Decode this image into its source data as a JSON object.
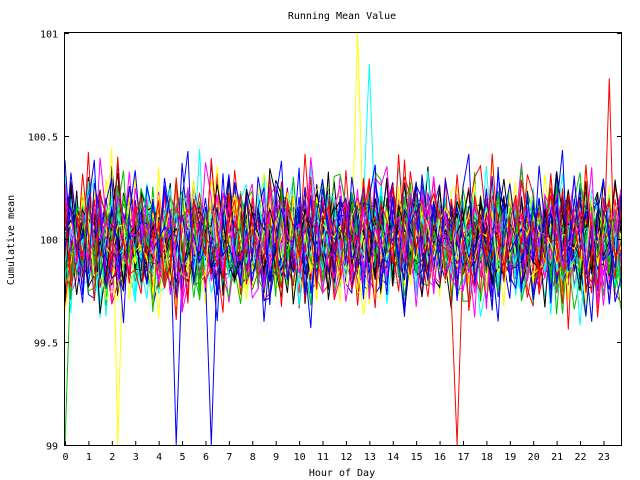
{
  "chart_data": {
    "type": "line",
    "title": "Running Mean Value",
    "xlabel": "Hour of Day",
    "ylabel": "Cumulative mean",
    "xlim": [
      0,
      23.75
    ],
    "ylim": [
      99,
      101
    ],
    "x_ticks": [
      0,
      1,
      2,
      3,
      4,
      5,
      6,
      7,
      8,
      9,
      10,
      11,
      12,
      13,
      14,
      15,
      16,
      17,
      18,
      19,
      20,
      21,
      22,
      23
    ],
    "x_tick_labels": [
      "0",
      "1",
      "2",
      "3",
      "4",
      "5",
      "6",
      "7",
      "8",
      "9",
      "10",
      "11",
      "12",
      "13",
      "14",
      "15",
      "16",
      "17",
      "18",
      "19",
      "20",
      "21",
      "22",
      "23"
    ],
    "y_ticks": [
      99,
      99.5,
      100,
      100.5,
      101
    ],
    "y_tick_labels": [
      "99",
      "99.5",
      "100",
      "100.5",
      "101"
    ],
    "grid": false,
    "legend": "none",
    "series_colors": [
      "#ff0000",
      "#00c000",
      "#0000ff",
      "#ff00ff",
      "#00ffff",
      "#000000",
      "#ffff00"
    ],
    "series_count": 60,
    "x_step_hours": 0.25,
    "series_sample": [
      {
        "color": "#0000ff",
        "values": [
          99.9,
          100.3,
          100.1,
          99.7,
          100.2,
          100.4,
          99.8,
          100.0,
          100.2,
          99.9,
          99.6,
          100.1,
          100.3,
          100.0,
          99.8,
          100.2
        ]
      },
      {
        "color": "#ff0000",
        "values": [
          100.1,
          99.8,
          99.9,
          100.3,
          100.0,
          99.7,
          100.2,
          100.1,
          99.9,
          100.4,
          100.0,
          99.8,
          100.1,
          100.2,
          99.9,
          100.0
        ]
      }
    ],
    "highlights": [
      {
        "x": 12.5,
        "y": 101.0,
        "color": "#ffff00"
      },
      {
        "x": 13.1,
        "y": 100.85,
        "color": "#00ffff"
      },
      {
        "x": 23.3,
        "y": 100.78,
        "color": "#ff0000"
      },
      {
        "x": 4.8,
        "y": 99.0,
        "color": "#0000ff"
      },
      {
        "x": 6.25,
        "y": 99.0,
        "color": "#0000ff"
      },
      {
        "x": 2.3,
        "y": 99.0,
        "color": "#ffff00"
      },
      {
        "x": 16.8,
        "y": 99.0,
        "color": "#ff0000"
      },
      {
        "x": 0.0,
        "y": 99.0,
        "color": "#00c000"
      }
    ]
  }
}
